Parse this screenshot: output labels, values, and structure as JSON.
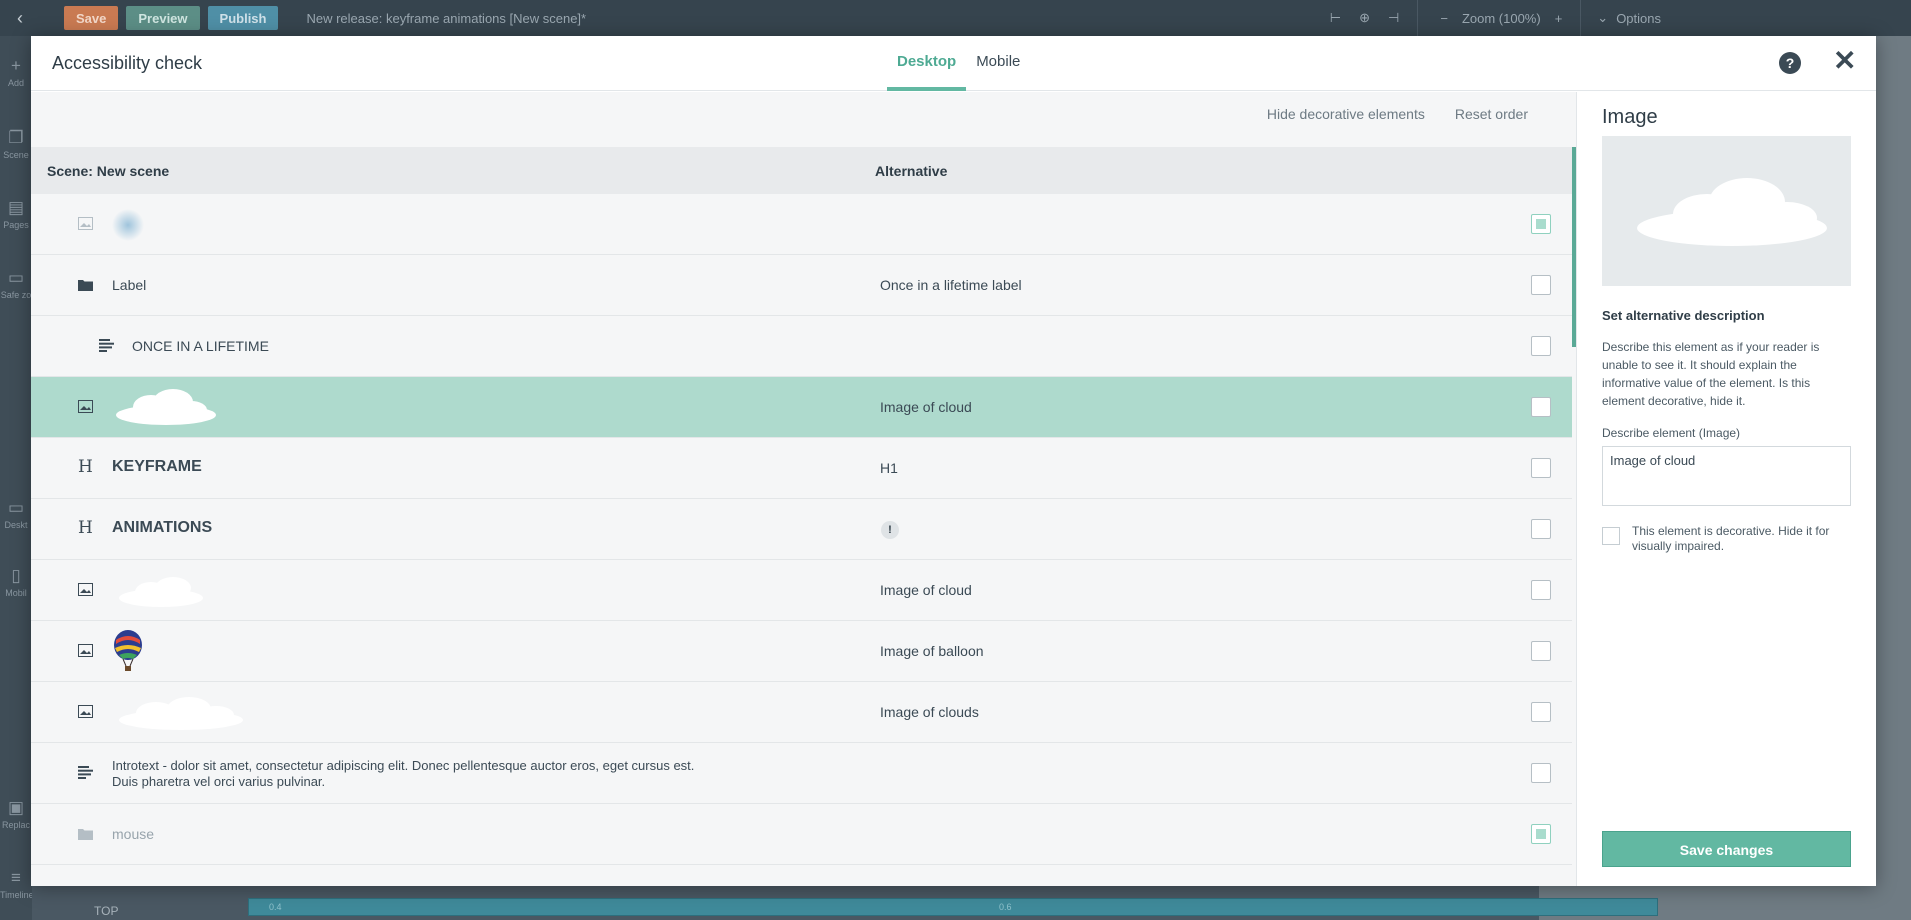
{
  "topbar": {
    "save": "Save",
    "preview": "Preview",
    "publish": "Publish",
    "title": "New release: keyframe animations [New scene]*",
    "zoom": "Zoom (100%)",
    "options": "Options"
  },
  "leftbar": [
    "Add",
    "Scene",
    "Pages",
    "Safe zo",
    "Deskt",
    "Mobil",
    "Replac",
    "Timeline"
  ],
  "timeline": {
    "row_label": "TOP",
    "bar_start": "0.4",
    "bar_mid": "0.6"
  },
  "modal": {
    "title": "Accessibility check",
    "tabs": [
      "Desktop",
      "Mobile"
    ],
    "help": "?",
    "close": "✕"
  },
  "actions": {
    "hide_decorative": "Hide decorative elements",
    "reset_order": "Reset order"
  },
  "table": {
    "col_scene": "Scene: New scene",
    "col_alternative": "Alternative",
    "rows": [
      {
        "type": "image",
        "name": "",
        "alt": "",
        "checked": true
      },
      {
        "type": "folder",
        "name": "Label",
        "alt": "Once in a lifetime label",
        "checked": false
      },
      {
        "type": "text",
        "name": "ONCE IN A LIFETIME",
        "alt": "",
        "checked": false
      },
      {
        "type": "image",
        "name": "",
        "alt": "Image of cloud",
        "checked": false
      },
      {
        "type": "heading",
        "name": "KEYFRAME",
        "alt": "H1",
        "checked": false
      },
      {
        "type": "heading",
        "name": "ANIMATIONS",
        "alt": "!",
        "checked": false
      },
      {
        "type": "image",
        "name": "",
        "alt": "Image of cloud",
        "checked": false
      },
      {
        "type": "image",
        "name": "",
        "alt": "Image of balloon",
        "checked": false
      },
      {
        "type": "image",
        "name": "",
        "alt": "Image of clouds",
        "checked": false
      },
      {
        "type": "text",
        "name": "Introtext - dolor sit amet, consectetur adipiscing elit. Donec pellentesque auctor eros, eget cursus est. Duis pharetra vel orci varius pulvinar.",
        "alt": "",
        "checked": false
      },
      {
        "type": "folder",
        "name": "mouse",
        "alt": "",
        "checked": true
      }
    ]
  },
  "panel": {
    "title": "Image",
    "set_title": "Set alternative description",
    "description": "Describe this element as if your reader is unable to see it. It should explain the informative value of the element. Is this element decorative, hide it.",
    "field_label": "Describe element (Image)",
    "field_value": "Image of cloud",
    "decorative_label": "This element is decorative. Hide it for visually impaired.",
    "save": "Save changes"
  }
}
